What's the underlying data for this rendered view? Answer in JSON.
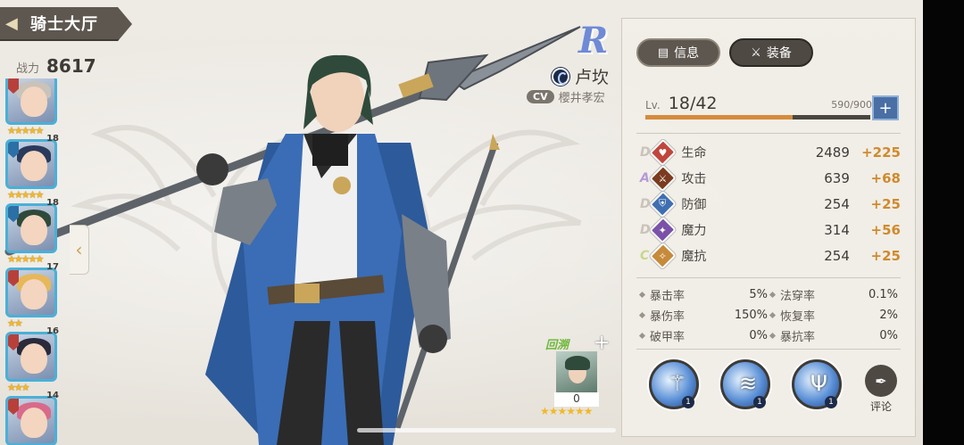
{
  "header": {
    "title": "骑士大厅",
    "power_label": "战力",
    "power_value": "8617"
  },
  "roster": [
    {
      "level": "",
      "stars": "★★★★★",
      "hair": "#c9c3b9",
      "tag": "#b8403a"
    },
    {
      "level": "18",
      "stars": "★★★★★",
      "hair": "#2b3a5a",
      "tag": "#2b6fa5"
    },
    {
      "level": "18",
      "stars": "★★★★★",
      "hair": "#2f4a3a",
      "tag": "#2b6fa5"
    },
    {
      "level": "17",
      "stars": "★★",
      "hair": "#e6b85a",
      "tag": "#b8403a"
    },
    {
      "level": "16",
      "stars": "★★★",
      "hair": "#2a2a3a",
      "tag": "#b8403a"
    },
    {
      "level": "14",
      "stars": "",
      "hair": "#d86a8a",
      "tag": "#b8403a"
    }
  ],
  "character": {
    "rarity": "R",
    "name": "卢坎",
    "cv_tag": "CV",
    "cv_name": "櫻井孝宏"
  },
  "regression": {
    "label": "回溯",
    "plus": "+",
    "count": "0",
    "stars": "★★★★★★"
  },
  "tabs": [
    {
      "label": "信息",
      "icon": "document-icon",
      "active": true
    },
    {
      "label": "装备",
      "icon": "crossed-swords-icon",
      "active": false
    }
  ],
  "level": {
    "label": "Lv.",
    "value": "18/42",
    "exp": "590/900",
    "exp_fraction": 0.656,
    "plus": "+"
  },
  "stats": [
    {
      "grade": "D",
      "name": "生命",
      "value": "2489",
      "bonus": "+225",
      "color": "#c0463c",
      "glyph": "♥"
    },
    {
      "grade": "A",
      "name": "攻击",
      "value": "639",
      "bonus": "+68",
      "color": "#7a3b1e",
      "glyph": "⚔"
    },
    {
      "grade": "D",
      "name": "防御",
      "value": "254",
      "bonus": "+25",
      "color": "#3f6fb0",
      "glyph": "⛨"
    },
    {
      "grade": "D",
      "name": "魔力",
      "value": "314",
      "bonus": "+56",
      "color": "#7a52a8",
      "glyph": "✦"
    },
    {
      "grade": "C",
      "name": "魔抗",
      "value": "254",
      "bonus": "+25",
      "color": "#c68a3a",
      "glyph": "✧"
    }
  ],
  "grade_colors": {
    "A": "#b69ad8",
    "C": "#c9d68a",
    "D": "#c9c3b9"
  },
  "sub_stats": [
    [
      {
        "name": "暴击率",
        "value": "5%"
      },
      {
        "name": "法穿率",
        "value": "0.1%"
      }
    ],
    [
      {
        "name": "暴伤率",
        "value": "150%"
      },
      {
        "name": "恢复率",
        "value": "2%"
      }
    ],
    [
      {
        "name": "破甲率",
        "value": "0%"
      },
      {
        "name": "暴抗率",
        "value": "0%"
      }
    ]
  ],
  "skills": [
    {
      "level": "1",
      "icon": "spear-skill-icon"
    },
    {
      "level": "1",
      "icon": "water-vortex-skill-icon"
    },
    {
      "level": "1",
      "icon": "trident-skill-icon"
    }
  ],
  "comment": {
    "label": "评论",
    "icon": "quill-pen-icon"
  }
}
